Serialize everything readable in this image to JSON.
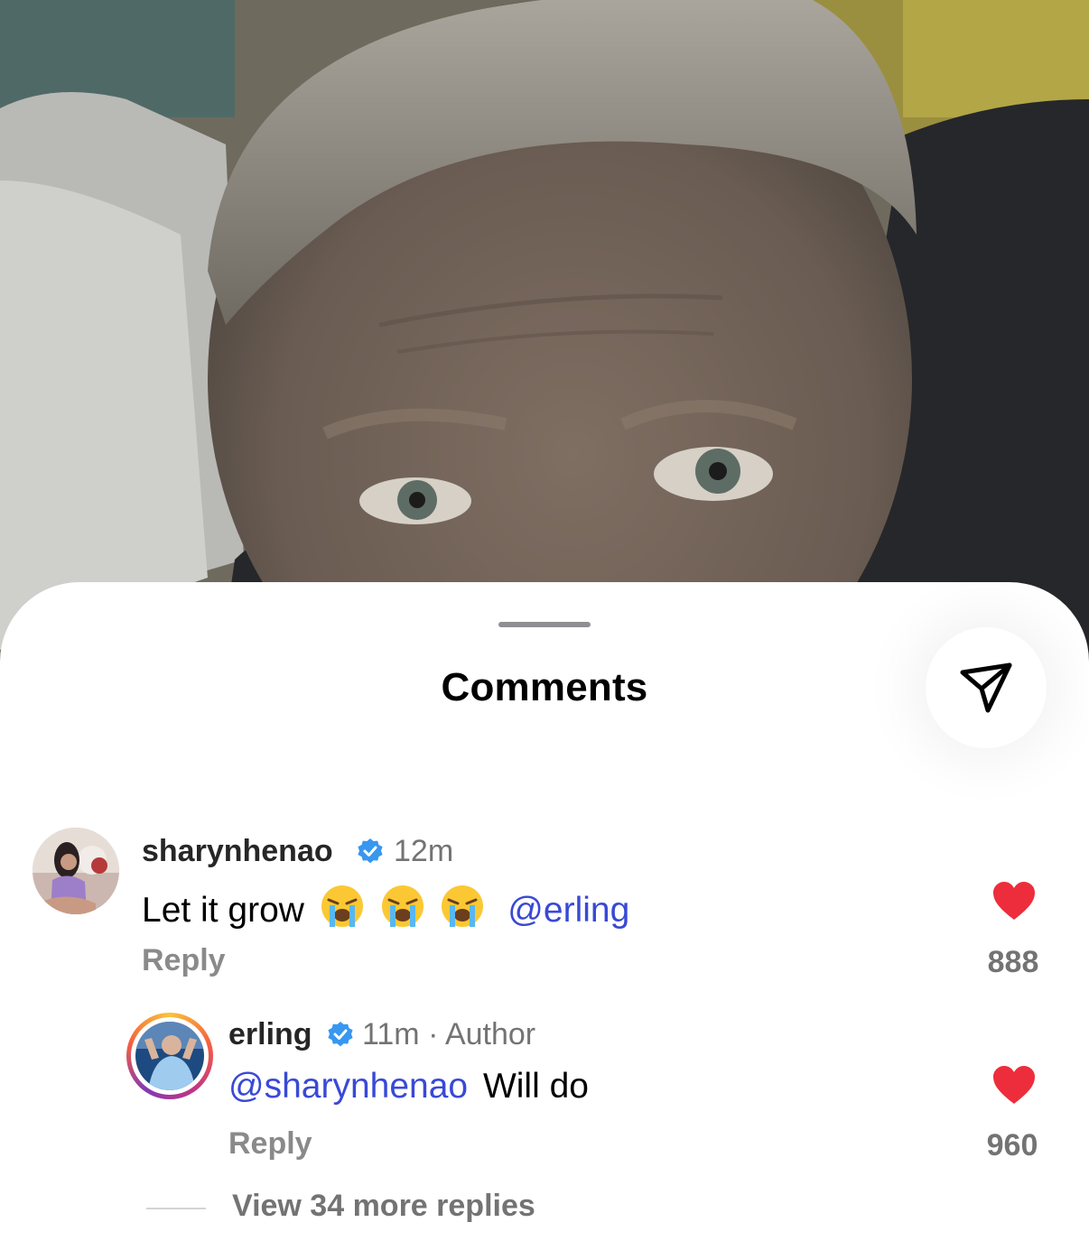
{
  "sheet": {
    "title": "Comments",
    "filter_icon": "filter-triangle-icon"
  },
  "comments": [
    {
      "username": "sharynhenao",
      "verified": true,
      "time": "12m",
      "text": "Let it grow",
      "emoji": [
        "loudly-crying-face",
        "loudly-crying-face",
        "loudly-crying-face"
      ],
      "mention": "@erling",
      "reply_label": "Reply",
      "likes": "888"
    }
  ],
  "reply": {
    "username": "erling",
    "verified": true,
    "time": "11m · Author",
    "mention": "@sharynhenao",
    "text": "Will do",
    "reply_label": "Reply",
    "likes": "960"
  },
  "view_more": "View 34 more replies",
  "colors": {
    "mention": "#3949d6",
    "heart": "#ed2d3b",
    "verified": "#3897f0"
  }
}
